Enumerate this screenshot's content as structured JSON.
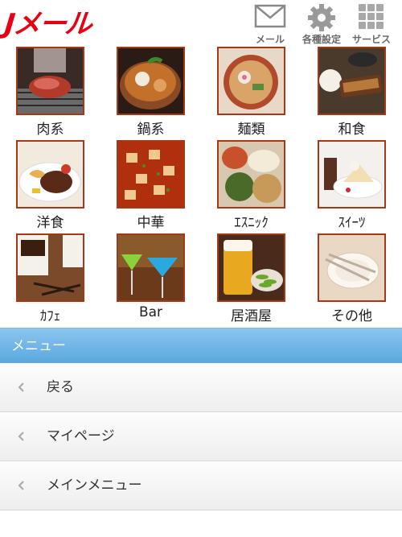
{
  "header": {
    "logo_text": "Jメール",
    "buttons": [
      {
        "label": "メール",
        "icon": "envelope-icon"
      },
      {
        "label": "各種設定",
        "icon": "gear-icon"
      },
      {
        "label": "サービス",
        "icon": "grid-icon"
      }
    ]
  },
  "categories": [
    {
      "label": "肉系",
      "image": "grilled-meat-photo"
    },
    {
      "label": "鍋系",
      "image": "hot-pot-photo"
    },
    {
      "label": "麺類",
      "image": "ramen-photo"
    },
    {
      "label": "和食",
      "image": "japanese-meal-photo"
    },
    {
      "label": "洋食",
      "image": "hamburg-steak-photo"
    },
    {
      "label": "中華",
      "image": "mapo-tofu-photo"
    },
    {
      "label": "ｴｽﾆｯｸ",
      "image": "ethnic-food-photo"
    },
    {
      "label": "ｽｲｰﾂ",
      "image": "sweets-photo"
    },
    {
      "label": "ｶﾌｪ",
      "image": "coffee-photo"
    },
    {
      "label": "Bar",
      "image": "cocktail-photo"
    },
    {
      "label": "居酒屋",
      "image": "beer-edamame-photo"
    },
    {
      "label": "その他",
      "image": "empty-plate-photo"
    }
  ],
  "menu": {
    "title": "メニュー",
    "items": [
      {
        "label": "戻る",
        "icon": "chevron-left-icon"
      },
      {
        "label": "マイページ",
        "icon": "chevron-left-icon"
      },
      {
        "label": "メインメニュー",
        "icon": "chevron-left-icon"
      }
    ]
  },
  "colors": {
    "brand_red": "#e60012",
    "menu_header_blue": "#6db3e6",
    "thumb_border": "#a23a1a"
  }
}
